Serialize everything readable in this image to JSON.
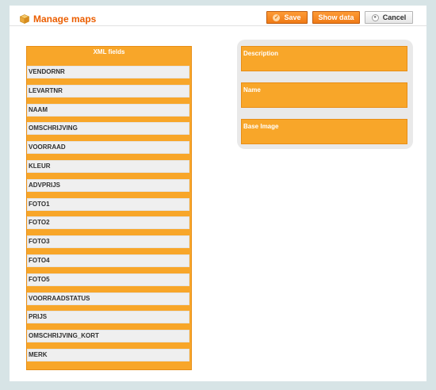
{
  "header": {
    "title": "Manage maps",
    "logo_icon": "cube-icon",
    "buttons": {
      "save": {
        "label": "Save",
        "icon": "check-circle-icon"
      },
      "show_data": {
        "label": "Show data"
      },
      "cancel": {
        "label": "Cancel",
        "icon": "circle-dot-icon"
      }
    }
  },
  "xml_fields": {
    "title": "XML fields",
    "items": [
      "VENDORNR",
      "LEVARTNR",
      "NAAM",
      "OMSCHRIJVING",
      "VOORRAAD",
      "KLEUR",
      "ADVPRIJS",
      "FOTO1",
      "FOTO2",
      "FOTO3",
      "FOTO4",
      "FOTO5",
      "VOORRAADSTATUS",
      "PRIJS",
      "OMSCHRIJVING_KORT",
      "MERK"
    ]
  },
  "targets": [
    "Description",
    "Name",
    "Base Image"
  ],
  "colors": {
    "accent": "#f8a629",
    "title": "#eb5e00",
    "background": "#d7e4e6"
  }
}
